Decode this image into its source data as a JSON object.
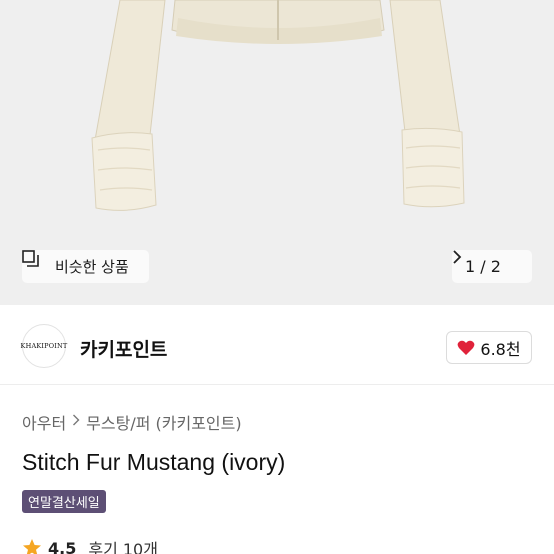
{
  "gallery": {
    "similar_button_label": "비슷한 상품",
    "current_page": "1",
    "total_pages": "2",
    "pager_separator": "/"
  },
  "shop": {
    "logo_text": "KHAKIPOINT",
    "name": "카키포인트",
    "likes": "6.8천"
  },
  "breadcrumb": {
    "category": "아우터",
    "subcategory": "무스탕/퍼 (카키포인트)"
  },
  "product": {
    "title": "Stitch Fur Mustang (ivory)",
    "badge": "연말결산세일",
    "rating": "4.5",
    "reviews": "후기 10개"
  },
  "colors": {
    "badge_bg": "#5d4f75",
    "heart": "#e0223a",
    "star": "#f5a623"
  }
}
